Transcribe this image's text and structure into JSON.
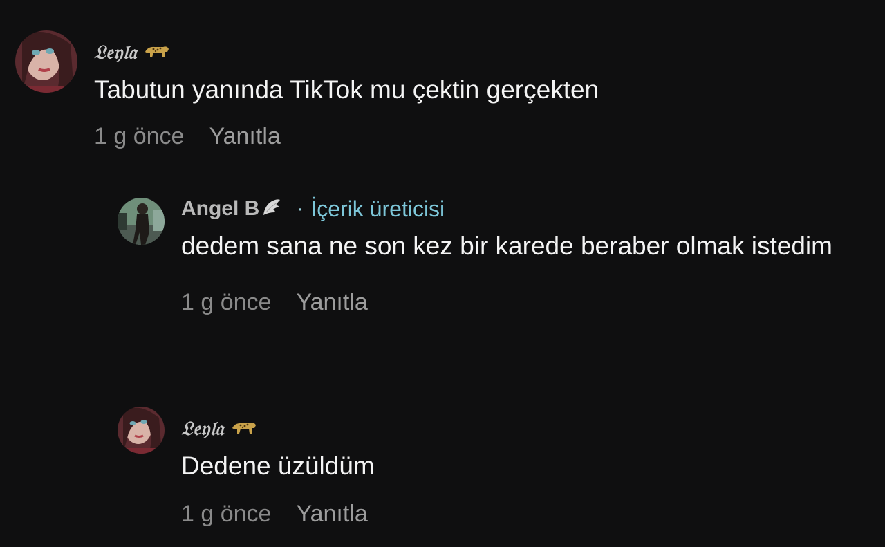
{
  "comments": [
    {
      "username": "𝔏𝔢𝔶𝔩𝔞",
      "badge_icon": "leopard-icon",
      "text": "Tabutun yanında TikTok mu çektin gerçekten",
      "time": "1 g önce",
      "reply_label": "Yanıtla"
    },
    {
      "username": "Angel B",
      "badge_icon": "wing-icon",
      "creator_label": "İçerik üreticisi",
      "separator": "·",
      "text": "dedem sana ne son kez bir karede beraber olmak istedim",
      "time": "1 g önce",
      "reply_label": "Yanıtla"
    },
    {
      "username": "𝔏𝔢𝔶𝔩𝔞",
      "badge_icon": "leopard-icon",
      "text": "Dedene üzüldüm",
      "time": "1 g önce",
      "reply_label": "Yanıtla"
    }
  ],
  "colors": {
    "background": "#0f0f10",
    "creator_accent": "#7dc6d8",
    "muted": "#8a8a8a"
  }
}
